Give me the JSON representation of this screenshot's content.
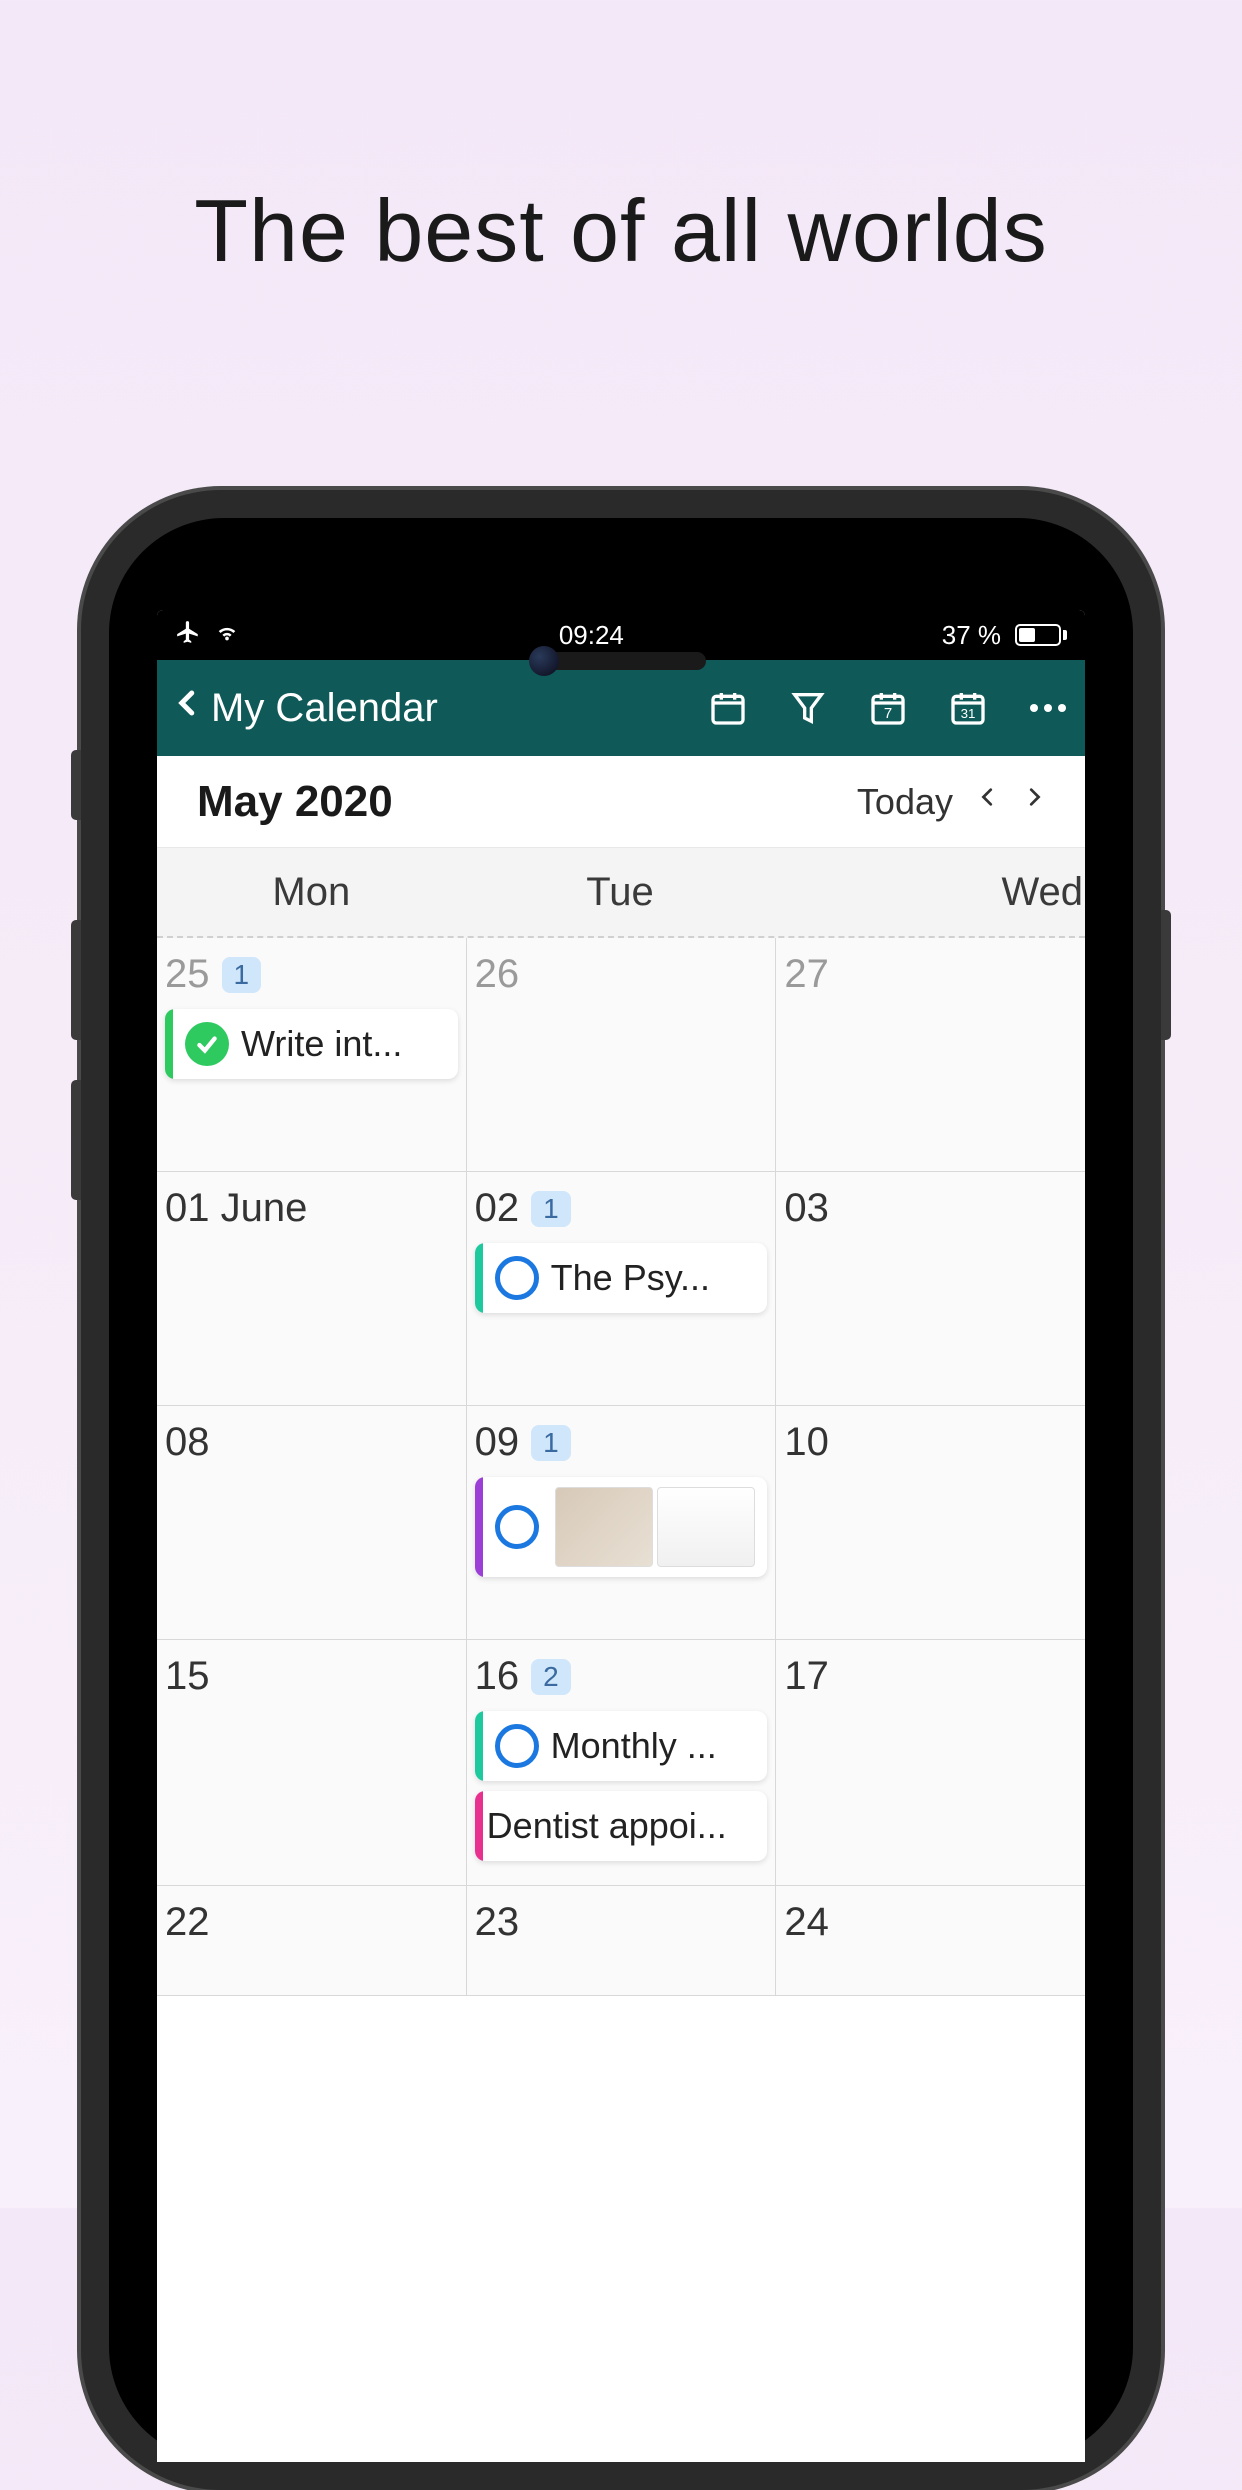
{
  "hero": {
    "title": "The best of all worlds"
  },
  "status": {
    "time": "09:24",
    "battery_text": "37 %"
  },
  "nav": {
    "back_title": "My Calendar"
  },
  "month": {
    "title": "May 2020",
    "today_label": "Today"
  },
  "day_headers": [
    "Mon",
    "Tue",
    "Wed"
  ],
  "weeks": [
    {
      "days": [
        {
          "num": "25",
          "muted": true,
          "badge": "1",
          "events": [
            {
              "stripe": "green",
              "check": "done",
              "label": "Write int..."
            }
          ]
        },
        {
          "num": "26",
          "muted": true
        },
        {
          "num": "27",
          "muted": true
        }
      ]
    },
    {
      "days": [
        {
          "num": "01 June"
        },
        {
          "num": "02",
          "badge": "1",
          "events": [
            {
              "stripe": "teal",
              "check": "empty",
              "label": "The Psy..."
            }
          ]
        },
        {
          "num": "03"
        }
      ]
    },
    {
      "days": [
        {
          "num": "08"
        },
        {
          "num": "09",
          "badge": "1",
          "events": [
            {
              "stripe": "purple",
              "check": "empty",
              "thumb": true
            }
          ]
        },
        {
          "num": "10"
        }
      ]
    },
    {
      "days": [
        {
          "num": "15"
        },
        {
          "num": "16",
          "badge": "2",
          "events": [
            {
              "stripe": "teal",
              "check": "empty",
              "label": "Monthly ..."
            },
            {
              "stripe": "pink",
              "label": "Dentist appoi..."
            }
          ]
        },
        {
          "num": "17"
        }
      ]
    },
    {
      "short": true,
      "days": [
        {
          "num": "22"
        },
        {
          "num": "23"
        },
        {
          "num": "24"
        }
      ]
    }
  ]
}
